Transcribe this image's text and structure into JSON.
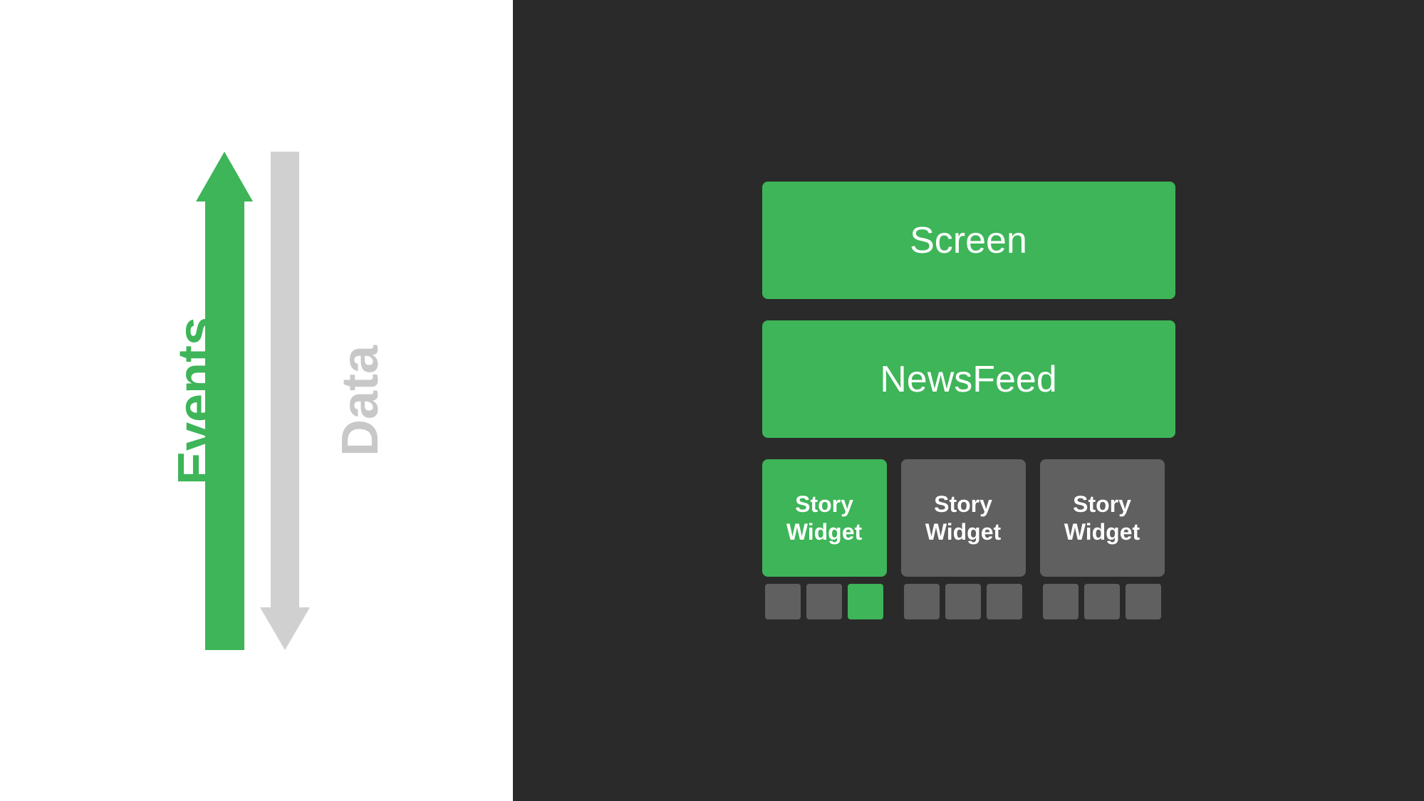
{
  "left_panel": {
    "events_label": "Events",
    "data_label": "Data",
    "events_color": "#3db558",
    "data_color": "#c8c8c8",
    "bg_color": "#ffffff"
  },
  "right_panel": {
    "bg_color": "#2a2a2a",
    "screen_label": "Screen",
    "newsfeed_label": "NewsFeed",
    "story_widgets": [
      {
        "label": "Story\nWidget",
        "color": "green"
      },
      {
        "label": "Story\nWidget",
        "color": "gray"
      },
      {
        "label": "Story\nWidget",
        "color": "gray"
      }
    ],
    "small_boxes_groups": [
      [
        false,
        false,
        true
      ],
      [
        false,
        false,
        false
      ],
      [
        false,
        false,
        false
      ]
    ]
  }
}
